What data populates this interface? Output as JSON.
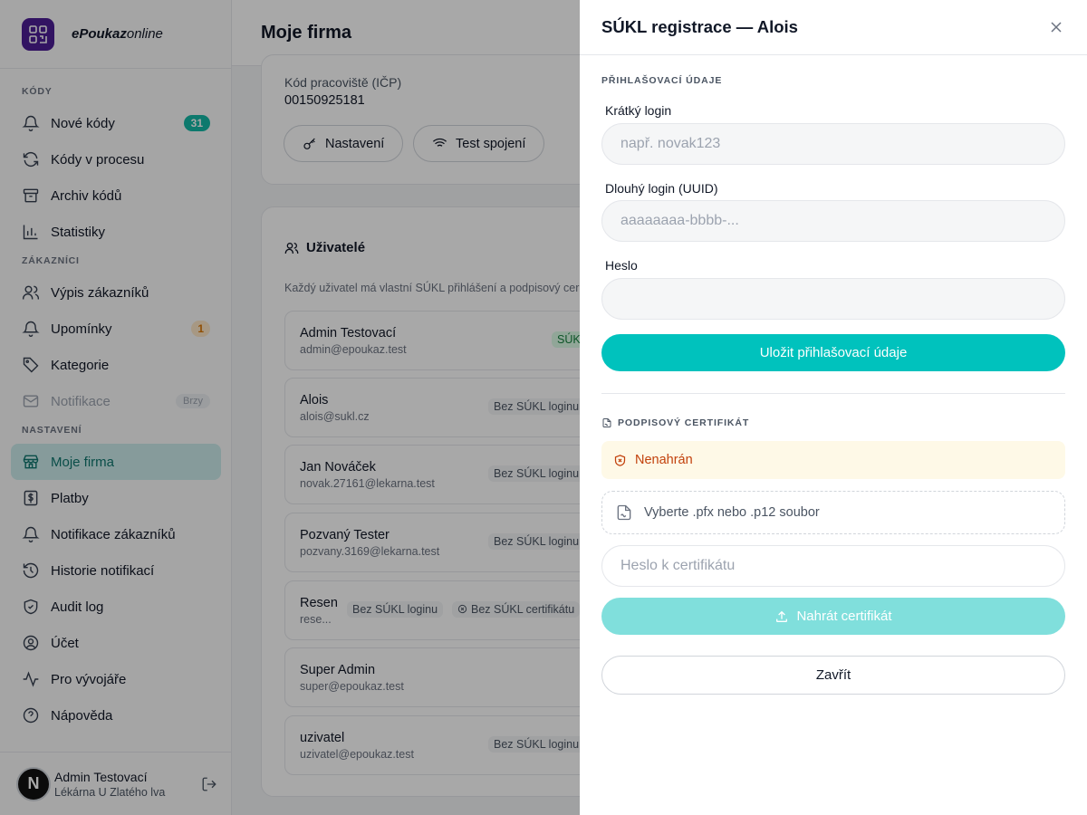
{
  "brand": {
    "name_bold": "ePoukaz",
    "name_rest": "online"
  },
  "sidebar": {
    "sections": {
      "kody": "KÓDY",
      "zakaznici": "ZÁKAZNÍCI",
      "nastaveni": "NASTAVENÍ"
    },
    "items": [
      {
        "label": "Nové kódy",
        "icon": "bell-icon",
        "badge": "31"
      },
      {
        "label": "Kódy v procesu",
        "icon": "refresh-icon"
      },
      {
        "label": "Archiv kódů",
        "icon": "archive-icon"
      },
      {
        "label": "Statistiky",
        "icon": "bar-chart-icon"
      },
      {
        "label": "Výpis zákazníků",
        "icon": "users-icon"
      },
      {
        "label": "Upomínky",
        "icon": "bell-icon",
        "badge": "1"
      },
      {
        "label": "Kategorie",
        "icon": "tag-icon"
      },
      {
        "label": "Notifikace",
        "icon": "mail-icon",
        "badge": "Brzy"
      },
      {
        "label": "Moje firma",
        "icon": "store-icon"
      },
      {
        "label": "Platby",
        "icon": "dollar-icon"
      },
      {
        "label": "Notifikace zákazníků",
        "icon": "bell-icon"
      },
      {
        "label": "Historie notifikací",
        "icon": "history-icon"
      },
      {
        "label": "Audit log",
        "icon": "shield-icon"
      },
      {
        "label": "Účet",
        "icon": "user-circle-icon"
      },
      {
        "label": "Pro vývojáře",
        "icon": "activity-icon"
      },
      {
        "label": "Nápověda",
        "icon": "help-icon"
      }
    ],
    "user": {
      "avatar": "N",
      "name": "Admin Testovací",
      "subtitle": "Lékárna U Zlatého lva"
    }
  },
  "main": {
    "title": "Moje firma",
    "workplace": {
      "label": "Kód pracoviště (IČP)",
      "value": "00150925181"
    },
    "buttons": {
      "settings": "Nastavení",
      "test": "Test spojení"
    },
    "users_card": {
      "title": "Uživatelé",
      "description": "Každý uživatel má vlastní SÚKL přihlášení a podpisový cer",
      "rows": [
        {
          "name": "Admin Testovací",
          "email": "admin@epoukaz.test",
          "tag": "SÚK"
        },
        {
          "name": "Alois",
          "email": "alois@sukl.cz",
          "tag": "Bez SÚKL loginu"
        },
        {
          "name": "Jan Nováček",
          "email": "novak.27161@lekarna.test",
          "tag": "Bez SÚKL loginu"
        },
        {
          "name": "Pozvaný Tester",
          "email": "pozvany.3169@lekarna.test",
          "tag": "Bez SÚKL loginu"
        },
        {
          "name": "Resen",
          "email": "rese...",
          "tag": "Bez SÚKL loginu",
          "tag2": "Bez SÚKL certifikátu"
        },
        {
          "name": "Super Admin",
          "email": "super@epoukaz.test",
          "tag": ""
        },
        {
          "name": "uzivatel",
          "email": "uzivatel@epoukaz.test",
          "tag": "Bez SÚKL loginu"
        }
      ]
    }
  },
  "drawer": {
    "title": "SÚKL registrace — Alois",
    "login_section": "PŘIHLAŠOVACÍ ÚDAJE",
    "short_login": {
      "label": "Krátký login",
      "placeholder": "např. novak123",
      "value": ""
    },
    "long_login": {
      "label": "Dlouhý login (UUID)",
      "placeholder": "aaaaaaaa-bbbb-...",
      "value": ""
    },
    "password": {
      "label": "Heslo",
      "placeholder": "",
      "value": ""
    },
    "save_button": "Uložit přihlašovací údaje",
    "cert_section": "PODPISOVÝ CERTIFIKÁT",
    "cert_status": "Nenahrán",
    "file_placeholder": "Vyberte .pfx nebo .p12 soubor",
    "cert_password": {
      "placeholder": "Heslo k certifikátu",
      "value": ""
    },
    "upload_button": "Nahrát certifikát",
    "close_button": "Zavřít"
  },
  "colors": {
    "accent": "#00c2bd",
    "brand": "#4c1d95",
    "warning_bg": "#fef9e7",
    "warning_text": "#c2410c"
  }
}
